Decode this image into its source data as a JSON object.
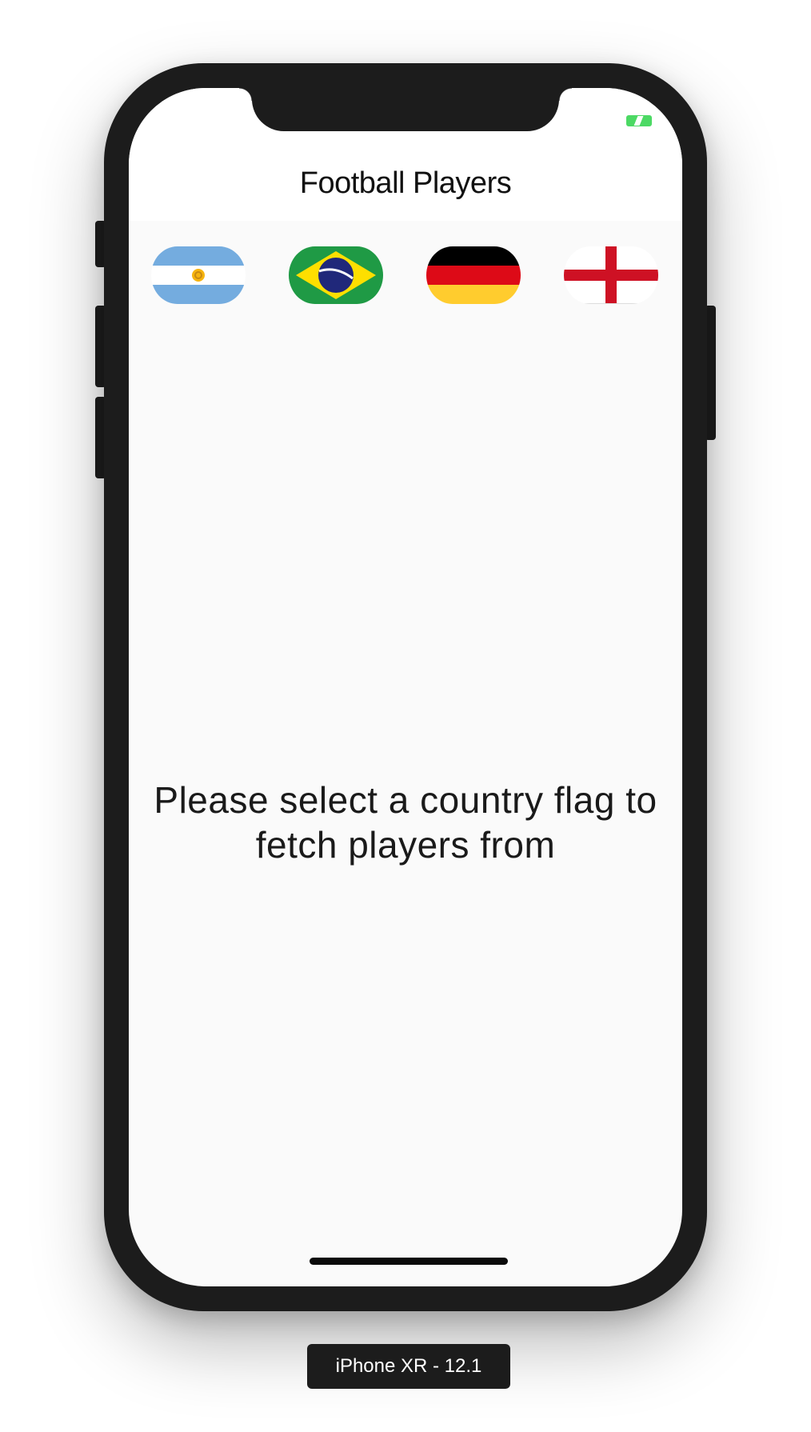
{
  "app": {
    "title": "Football Players",
    "empty_message": "Please select a country flag to fetch players from"
  },
  "status_bar": {
    "battery_icon": "battery-charging-icon",
    "battery_color": "#4cd964"
  },
  "flags": [
    {
      "country": "Argentina",
      "icon": "argentina-flag-icon"
    },
    {
      "country": "Brazil",
      "icon": "brazil-flag-icon"
    },
    {
      "country": "Germany",
      "icon": "germany-flag-icon"
    },
    {
      "country": "England",
      "icon": "england-flag-icon"
    }
  ],
  "simulator": {
    "device_label": "iPhone XR - 12.1"
  }
}
